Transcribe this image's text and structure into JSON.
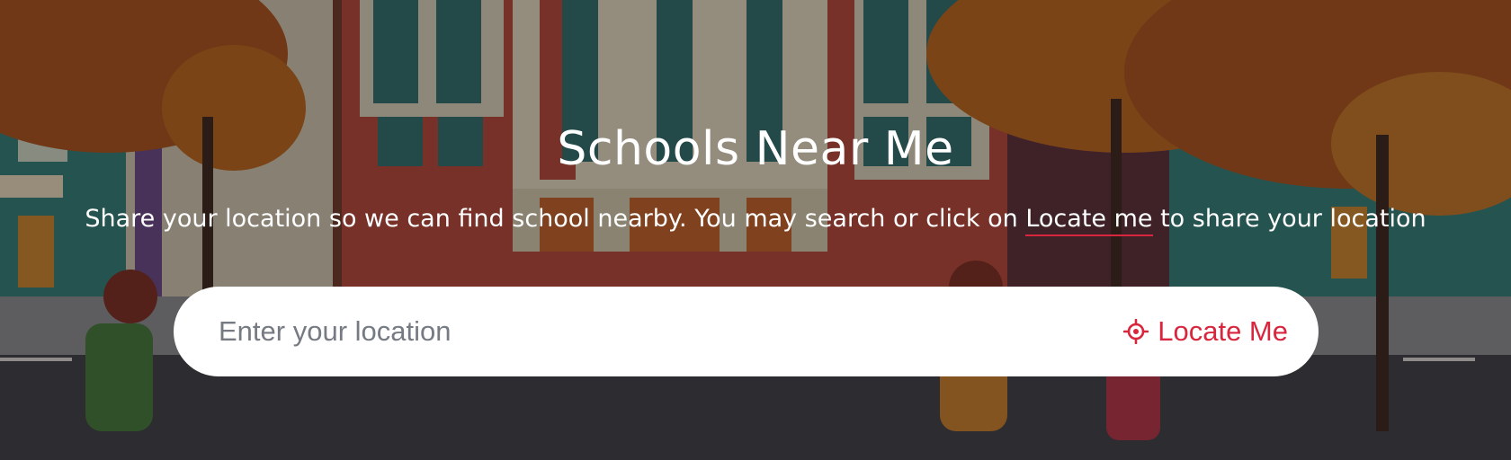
{
  "hero": {
    "title": "Schools Near Me",
    "subtitle_before": "Share your location so we can find school nearby. You may search or click on ",
    "subtitle_link": "Locate me",
    "subtitle_after": " to share your location"
  },
  "search": {
    "placeholder": "Enter your location",
    "value": "",
    "locate_label": "Locate Me",
    "locate_icon": "crosshair-icon"
  },
  "colors": {
    "accent": "#d7263d",
    "title_text": "#ffffff",
    "placeholder": "#767a82"
  }
}
